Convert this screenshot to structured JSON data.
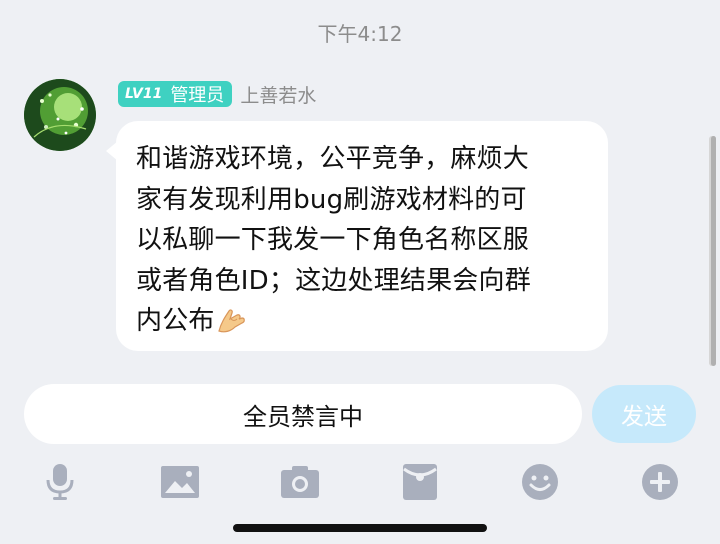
{
  "status": {
    "time": "下午4:12"
  },
  "message": {
    "level_badge": "LV11",
    "role_badge": "管理员",
    "sender_name": "上善若水",
    "lines": [
      "和谐游戏环境，公平竞争，麻烦大",
      "家有发现利用bug刷游戏材料的可",
      "以私聊一下我发一下角色名称区服",
      "或者角色ID；这边处理结果会向群",
      "内公布"
    ],
    "emoji": "pinching-hand-emoji"
  },
  "input": {
    "placeholder": "全员禁言中"
  },
  "send_button": {
    "label": "发送"
  },
  "toolbar": {
    "icons": [
      "microphone-icon",
      "image-icon",
      "camera-icon",
      "red-packet-icon",
      "emoji-icon",
      "plus-icon"
    ]
  },
  "colors": {
    "background": "#eef0f4",
    "badge": "#3fd1c1",
    "send_button": "#c6e9fb",
    "icon": "#a9afbd"
  }
}
